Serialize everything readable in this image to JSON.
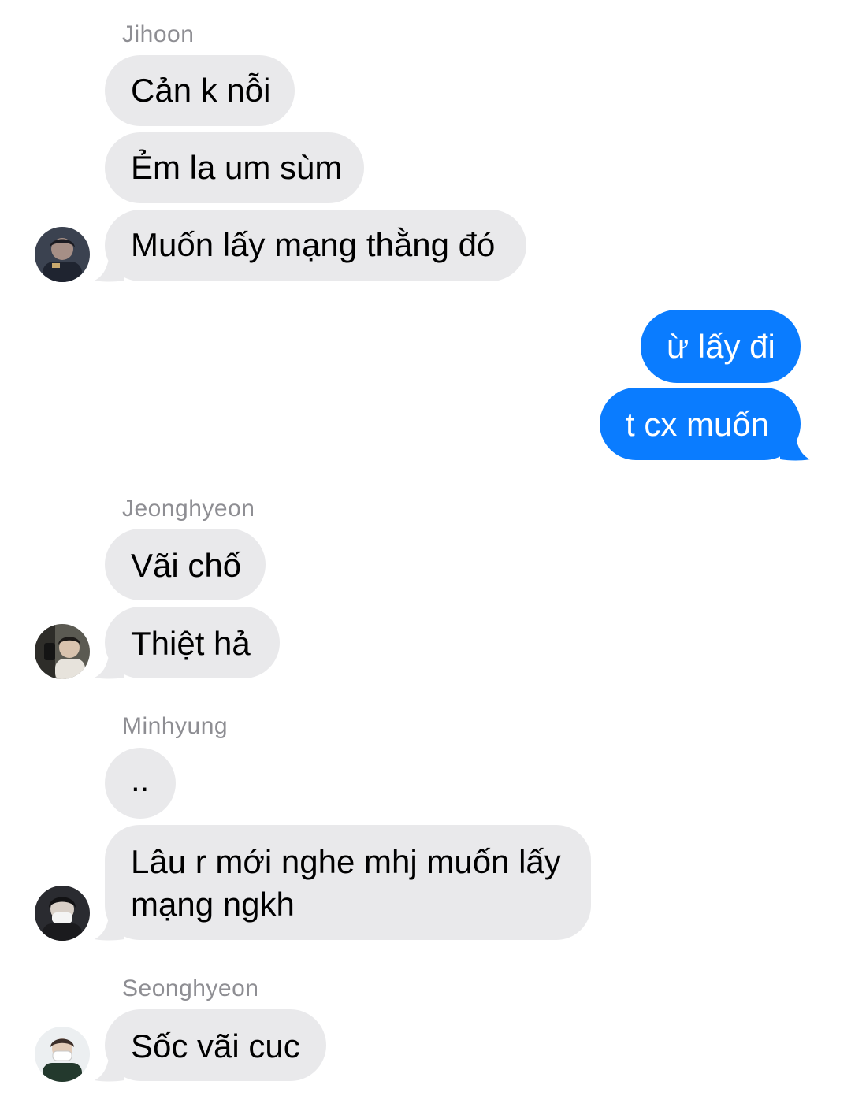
{
  "colors": {
    "incoming_bubble": "#e9e9eb",
    "outgoing_bubble": "#0a7cff",
    "sender_name": "#8e8e93"
  },
  "groups": [
    {
      "sender": "Jihoon",
      "avatar_icon": "user-avatar-jihoon",
      "messages": [
        "Cản k nỗi",
        "Ẻm la um sùm",
        "Muốn lấy mạng thằng đó"
      ]
    },
    {
      "sender": "",
      "outgoing": true,
      "messages": [
        "ừ lấy đi",
        "t cx muốn"
      ]
    },
    {
      "sender": "Jeonghyeon",
      "avatar_icon": "user-avatar-jeonghyeon",
      "messages": [
        "Vãi chố",
        "Thiệt hả"
      ]
    },
    {
      "sender": "Minhyung",
      "avatar_icon": "user-avatar-minhyung",
      "messages": [
        "..",
        "Lâu r mới nghe mhj muốn lấy mạng ngkh"
      ]
    },
    {
      "sender": "Seonghyeon",
      "avatar_icon": "user-avatar-seonghyeon",
      "messages": [
        "Sốc vãi cuc"
      ]
    }
  ]
}
